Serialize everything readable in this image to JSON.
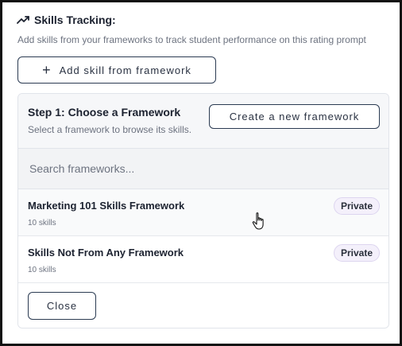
{
  "skills": {
    "title": "Skills Tracking:",
    "description": "Add skills from your frameworks to track student performance on this rating prompt",
    "add_button_label": "Add skill from framework",
    "trend_icon": "trending-up-icon",
    "plus_icon": "plus-icon"
  },
  "picker": {
    "step_title": "Step 1: Choose a Framework",
    "step_description": "Select a framework to browse its skills.",
    "create_button_label": "Create a new framework",
    "search": {
      "placeholder": "Search frameworks...",
      "value": ""
    },
    "frameworks": [
      {
        "name": "Marketing 101 Skills Framework",
        "count": "10 skills",
        "badge": "Private"
      },
      {
        "name": "Skills Not From Any Framework",
        "count": "10 skills",
        "badge": "Private"
      }
    ],
    "close_button_label": "Close"
  },
  "colors": {
    "badge_bg": "#f4f0fb",
    "button_border": "#2b3b52",
    "panel_bg": "#f6f7f9"
  }
}
